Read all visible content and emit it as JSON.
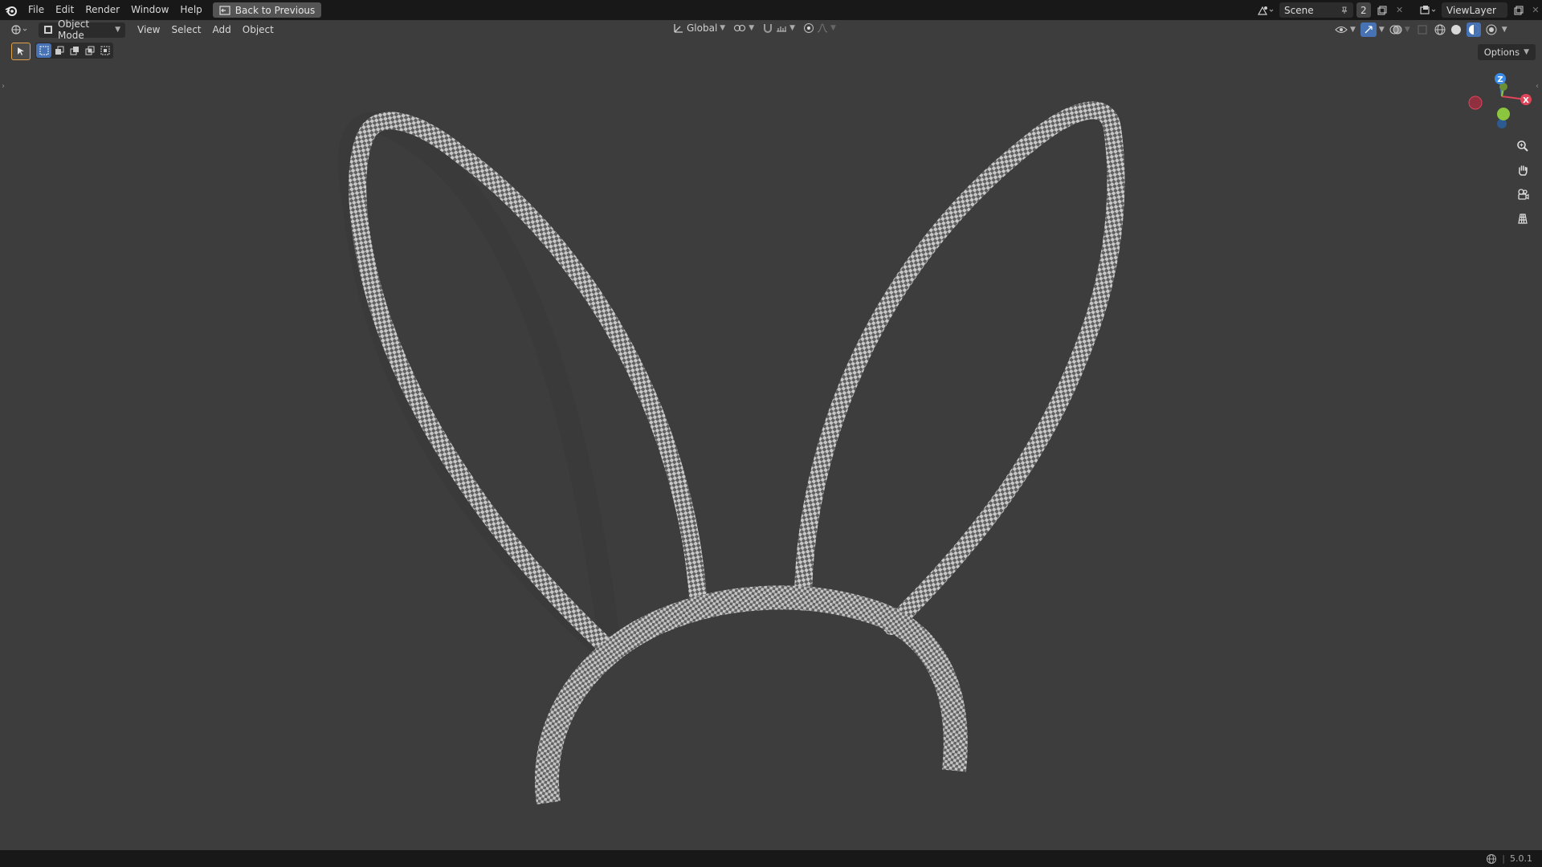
{
  "app": {
    "menus": [
      "File",
      "Edit",
      "Render",
      "Window",
      "Help"
    ],
    "back_button": "Back to Previous",
    "scene_name": "Scene",
    "scene_users": "2",
    "view_layer": "ViewLayer"
  },
  "viewport_header": {
    "mode": "Object Mode",
    "menus": [
      "View",
      "Select",
      "Add",
      "Object"
    ],
    "transform_orientation": "Global"
  },
  "viewport": {
    "options_label": "Options",
    "gizmo": {
      "z_label": "Z",
      "y_label": "Y",
      "x_label": "X"
    },
    "navigation": [
      "zoom-icon",
      "pan-hand-icon",
      "camera-view-icon",
      "ortho-grid-icon"
    ],
    "object": "bunny-ears-headband",
    "texture": "checker"
  },
  "status": {
    "version": "5.0.1"
  },
  "colors": {
    "top_bar": "#181818",
    "viewport_bg": "#3d3d3d",
    "accent_blue": "#4772b3",
    "axis_x": "#e0455a",
    "axis_y": "#8cc63f",
    "axis_z": "#3b8be8"
  }
}
